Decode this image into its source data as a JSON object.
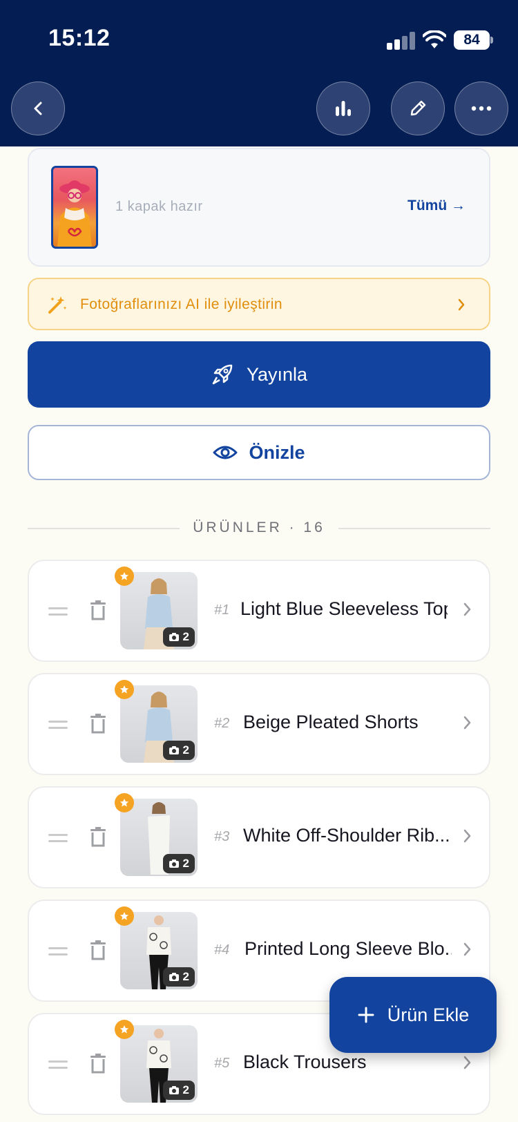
{
  "status_bar": {
    "time": "15:12",
    "battery": "84"
  },
  "cover": {
    "text": "1 kapak hazır",
    "link": "Tümü →"
  },
  "ai_banner": {
    "text": "Fotoğraflarınızı AI ile iyileştirin"
  },
  "publish": {
    "label": "Yayınla"
  },
  "preview": {
    "label": "Önizle"
  },
  "section": {
    "title": "ÜRÜNLER · 16"
  },
  "products": [
    {
      "num": "#1",
      "name": "Light Blue Sleeveless Top",
      "photos": "2"
    },
    {
      "num": "#2",
      "name": "Beige Pleated Shorts",
      "photos": "2"
    },
    {
      "num": "#3",
      "name": "White Off-Shoulder Rib...",
      "photos": "2"
    },
    {
      "num": "#4",
      "name": "Printed Long Sleeve Blo...",
      "photos": "2"
    },
    {
      "num": "#5",
      "name": "Black Trousers",
      "photos": "2"
    }
  ],
  "fab": {
    "label": "Ürün Ekle"
  },
  "colors": {
    "header": "#041d53",
    "primary": "#12449f",
    "accent": "#f5a323",
    "warning_bg": "#fff6e2"
  }
}
